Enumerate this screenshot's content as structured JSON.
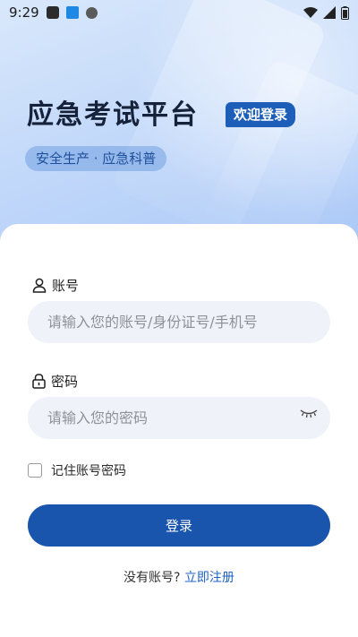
{
  "status_bar": {
    "time": "9:29",
    "left_icons": [
      "app-square-icon",
      "app-badge-icon",
      "circle-icon"
    ],
    "right_icons": [
      "wifi-icon",
      "signal-icon",
      "battery-icon"
    ]
  },
  "hero": {
    "title": "应急考试平台",
    "badge": "欢迎登录",
    "subtitle": "安全生产 · 应急科普"
  },
  "form": {
    "account": {
      "label": "账号",
      "icon": "user-icon",
      "placeholder": "请输入您的账号/身份证号/手机号"
    },
    "password": {
      "label": "密码",
      "icon": "lock-icon",
      "placeholder": "请输入您的密码",
      "toggle_icon": "eye-closed-icon"
    },
    "remember_label": "记住账号密码",
    "login_button": "登录",
    "register_prompt": "没有账号?",
    "register_link": "立即注册"
  },
  "colors": {
    "primary": "#1a55ad",
    "badge": "#1d5fb8",
    "link": "#1f63c6",
    "input_bg": "#eff2f9"
  }
}
